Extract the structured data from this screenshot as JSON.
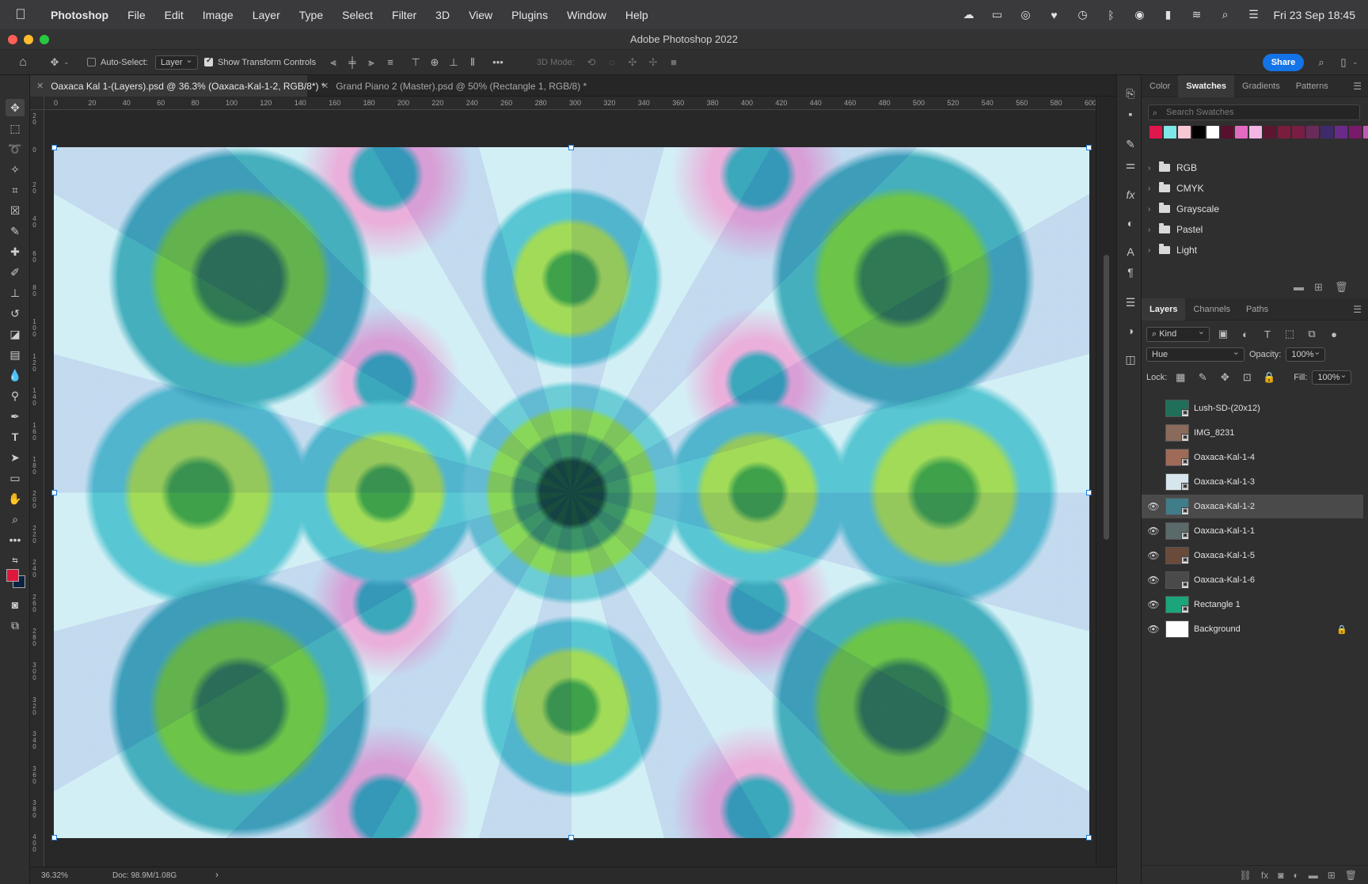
{
  "menubar": {
    "app": "Photoshop",
    "items": [
      "File",
      "Edit",
      "Image",
      "Layer",
      "Type",
      "Select",
      "Filter",
      "3D",
      "View",
      "Plugins",
      "Window",
      "Help"
    ],
    "clock": "Fri 23 Sep  18:45",
    "status_icons": [
      "cloud-icon",
      "screen-mirror-icon",
      "creative-cloud-icon",
      "antivirus-icon",
      "time-machine-icon",
      "bluetooth-icon",
      "airdrop-icon",
      "battery-icon",
      "wifi-icon",
      "spotlight-icon",
      "control-center-icon"
    ]
  },
  "window": {
    "title": "Adobe Photoshop 2022"
  },
  "options_bar": {
    "auto_select_label": "Auto-Select:",
    "auto_select_value": "Layer",
    "show_transform_label": "Show Transform Controls",
    "mode_3d_label": "3D Mode:",
    "share_label": "Share"
  },
  "tabs": [
    {
      "label": "Oaxaca Kal 1-(Layers).psd @ 36.3% (Oaxaca-Kal-1-2, RGB/8*) *",
      "active": true
    },
    {
      "label": "Grand Piano 2 (Master).psd @ 50% (Rectangle 1, RGB/8) *",
      "active": false
    }
  ],
  "ruler_h": [
    "0",
    "20",
    "40",
    "60",
    "80",
    "100",
    "120",
    "140",
    "160",
    "180",
    "200",
    "220",
    "240",
    "260",
    "280",
    "300",
    "320",
    "340",
    "360",
    "380",
    "400",
    "420",
    "440",
    "460",
    "480",
    "500",
    "520",
    "540",
    "560",
    "580",
    "600"
  ],
  "ruler_v": [
    "20",
    "0",
    "20",
    "40",
    "60",
    "80",
    "100",
    "120",
    "140",
    "160",
    "180",
    "200",
    "220",
    "240",
    "260",
    "280",
    "300",
    "320",
    "340",
    "360",
    "380",
    "400"
  ],
  "status": {
    "zoom": "36.32%",
    "doc": "Doc: 98.9M/1.08G",
    "arrow": "›"
  },
  "swatches": {
    "tabs": [
      "Color",
      "Swatches",
      "Gradients",
      "Patterns"
    ],
    "active_tab": "Swatches",
    "search_placeholder": "Search Swatches",
    "recent": [
      "#e0174d",
      "#7ee8e8",
      "#f7c7d2",
      "#000000",
      "#ffffff",
      "#5a0f2e",
      "#e36ac1",
      "#f4b5e3",
      "#5c1631",
      "#7a1c3d",
      "#7a1d44",
      "#6a2a5a",
      "#3f2a6b",
      "#6b2a8a",
      "#7a1a6a",
      "#c05ab8",
      "#4a1a4a"
    ],
    "groups": [
      "RGB",
      "CMYK",
      "Grayscale",
      "Pastel",
      "Light"
    ]
  },
  "layers": {
    "tabs": [
      "Layers",
      "Channels",
      "Paths"
    ],
    "active_tab": "Layers",
    "filter_kind": "Kind",
    "blend_mode": "Hue",
    "opacity_label": "Opacity:",
    "opacity_value": "100%",
    "lock_label": "Lock:",
    "fill_label": "Fill:",
    "fill_value": "100%",
    "items": [
      {
        "name": "Lush-SD-(20x12)",
        "visible": false,
        "selected": false,
        "thumb": "#1f6f5a"
      },
      {
        "name": "IMG_8231",
        "visible": false,
        "selected": false,
        "thumb": "#8a6a5a"
      },
      {
        "name": "Oaxaca-Kal-1-4",
        "visible": false,
        "selected": false,
        "thumb": "#a06a58"
      },
      {
        "name": "Oaxaca-Kal-1-3",
        "visible": false,
        "selected": false,
        "thumb": "#d6e6ec"
      },
      {
        "name": "Oaxaca-Kal-1-2",
        "visible": true,
        "selected": true,
        "thumb": "#3f7d88"
      },
      {
        "name": "Oaxaca-Kal-1-1",
        "visible": true,
        "selected": false,
        "thumb": "#5a6a6a"
      },
      {
        "name": "Oaxaca-Kal-1-5",
        "visible": true,
        "selected": false,
        "thumb": "#6a4a3a"
      },
      {
        "name": "Oaxaca-Kal-1-6",
        "visible": true,
        "selected": false,
        "thumb": "#4a4a4a"
      },
      {
        "name": "Rectangle 1",
        "visible": true,
        "selected": false,
        "thumb": "#1aa57a"
      },
      {
        "name": "Background",
        "visible": true,
        "selected": false,
        "thumb": "#ffffff",
        "locked": true
      }
    ]
  },
  "colors": {
    "accent": "#1473e6",
    "foreground": "#e0173d",
    "background": "#0a2340",
    "selection_handle": "#1a7ad9"
  }
}
